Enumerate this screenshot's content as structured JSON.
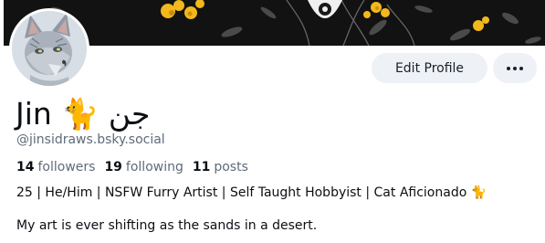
{
  "profile": {
    "display_name": "Jin 🐈 جن",
    "handle": "@jinsidraws.bsky.social",
    "stats": {
      "followers_count": "14",
      "followers_label": "followers",
      "following_count": "19",
      "following_label": "following",
      "posts_count": "11",
      "posts_label": "posts"
    },
    "bio_line1": "25 | He/Him | NSFW Furry Artist | Self Taught Hobbyist | Cat Aficionado 🐈",
    "bio_line2": "My art is ever shifting as the sands in a desert."
  },
  "actions": {
    "edit_profile_label": "Edit Profile",
    "more_icon": "ellipsis-icon"
  },
  "colors": {
    "banner_bg": "#121212",
    "banner_flowers": "#f2b81c",
    "button_bg": "#eef1f5",
    "muted_text": "#5f6b7a"
  }
}
